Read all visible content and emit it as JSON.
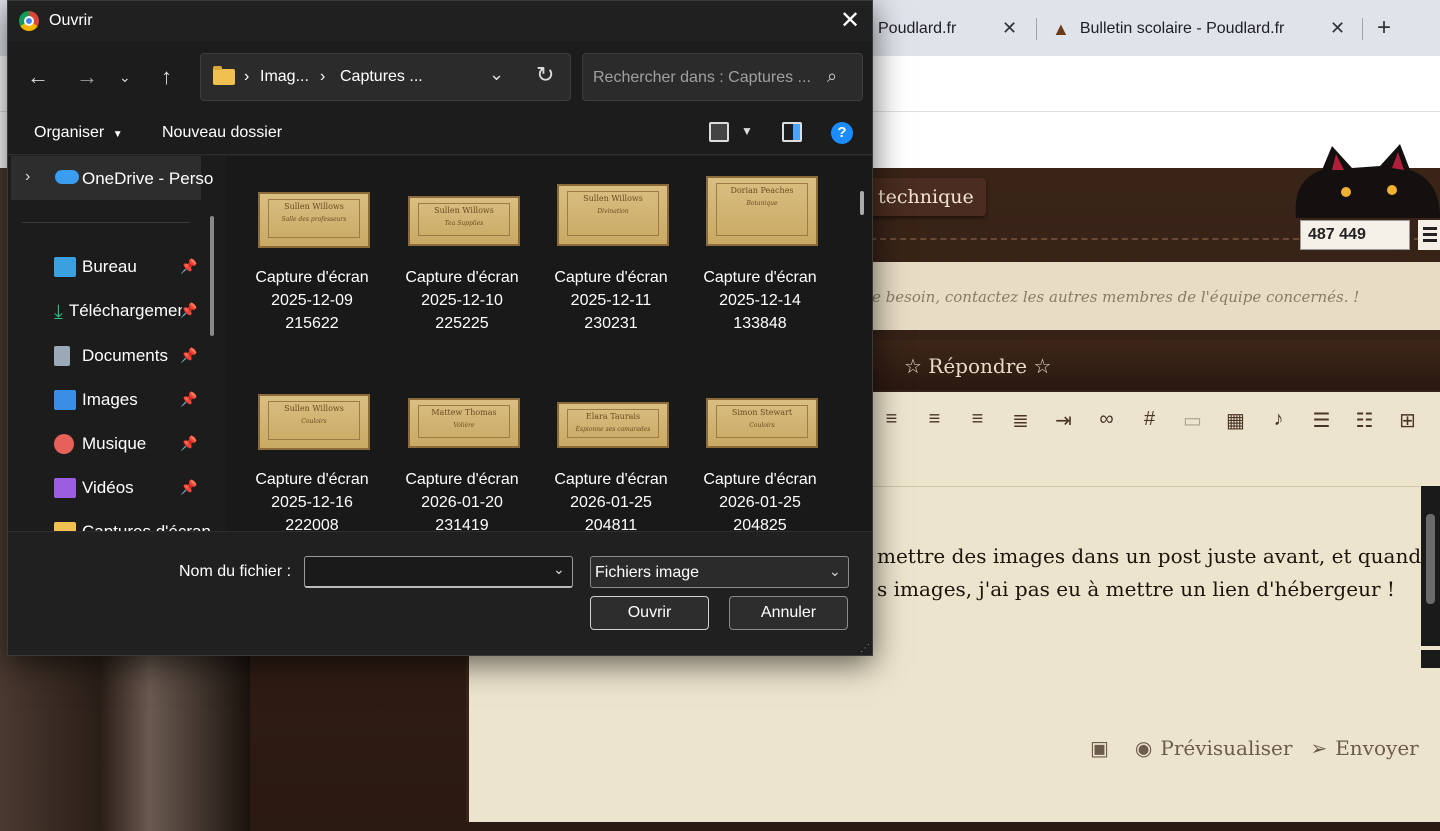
{
  "browser": {
    "tabs": [
      {
        "label": "Poudlard.fr"
      },
      {
        "label": "Bulletin scolaire - Poudlard.fr"
      }
    ],
    "new_tab": "+",
    "close_glyph": "✕"
  },
  "site": {
    "tech_button": "technique",
    "counter": "487 449",
    "notice": "e besoin, contactez les autres membres de l'équipe concernés. !",
    "reply_title": "☆ Répondre ☆",
    "post_lines": [
      "mettre des images dans un post juste avant, et quand",
      "s images, j'ai pas eu à mettre un lien d'hébergeur !"
    ],
    "actions": {
      "preview": "Prévisualiser",
      "send": "Envoyer"
    }
  },
  "dialog": {
    "title": "Ouvrir",
    "breadcrumb": [
      "Imag...",
      "Captures ..."
    ],
    "search_placeholder": "Rechercher dans : Captures ...",
    "commands": {
      "organize": "Organiser",
      "new_folder": "Nouveau dossier",
      "help": "?"
    },
    "nav": {
      "onedrive": "OneDrive - Perso",
      "items": [
        {
          "label": "Bureau",
          "color": "#3aa0e0"
        },
        {
          "label": "Téléchargements",
          "color": "#2ec27e"
        },
        {
          "label": "Documents",
          "color": "#9aa8b8"
        },
        {
          "label": "Images",
          "color": "#3a8ee6"
        },
        {
          "label": "Musique",
          "color": "#e8605a"
        },
        {
          "label": "Vidéos",
          "color": "#9b5ee0"
        },
        {
          "label": "Captures d'écran",
          "color": "#f0c050"
        }
      ]
    },
    "files": [
      {
        "l1": "Capture d'écran",
        "l2": "2025-12-09",
        "l3": "215622",
        "thumb_name": "Sullen Willows",
        "thumb_sub": "Salle des professeurs"
      },
      {
        "l1": "Capture d'écran",
        "l2": "2025-12-10",
        "l3": "225225",
        "thumb_name": "Sullen Willows",
        "thumb_sub": "Tea Supplies"
      },
      {
        "l1": "Capture d'écran",
        "l2": "2025-12-11",
        "l3": "230231",
        "thumb_name": "Sullen Willows",
        "thumb_sub": "Divination"
      },
      {
        "l1": "Capture d'écran",
        "l2": "2025-12-14",
        "l3": "133848",
        "thumb_name": "Dorian Peaches",
        "thumb_sub": "Botanique"
      },
      {
        "l1": "Capture d'écran",
        "l2": "2025-12-16",
        "l3": "222008",
        "thumb_name": "Sullen Willows",
        "thumb_sub": "Couloirs"
      },
      {
        "l1": "Capture d'écran",
        "l2": "2026-01-20",
        "l3": "231419",
        "thumb_name": "Mattew Thomas",
        "thumb_sub": "Volière"
      },
      {
        "l1": "Capture d'écran",
        "l2": "2026-01-25",
        "l3": "204811",
        "thumb_name": "Elara Taurais",
        "thumb_sub": "Espionne ses camarades"
      },
      {
        "l1": "Capture d'écran",
        "l2": "2026-01-25",
        "l3": "204825",
        "thumb_name": "Simon Stewart",
        "thumb_sub": "Couloirs"
      }
    ],
    "filename_label": "Nom du fichier :",
    "filename_value": "",
    "file_type": "Fichiers image",
    "open_button": "Ouvrir",
    "cancel_button": "Annuler"
  }
}
